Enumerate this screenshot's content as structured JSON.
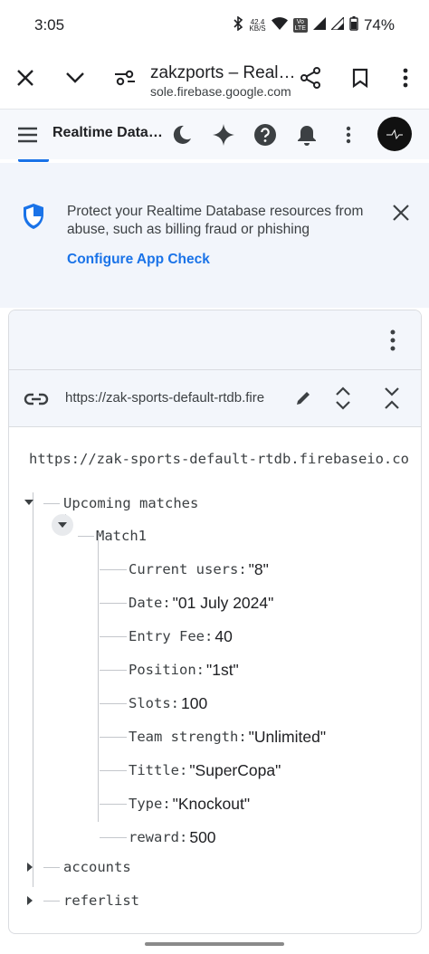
{
  "status_bar": {
    "time": "3:05",
    "net_speed_value": "42.4",
    "net_speed_unit": "KB/S",
    "volte_top": "Vo",
    "volte_bottom": "LTE",
    "battery": "74%"
  },
  "browser": {
    "page_title": "zakzports – Real…",
    "page_url": "sole.firebase.google.com",
    "icons": [
      "close-icon",
      "chevron-down-icon",
      "site-settings-icon",
      "share-icon",
      "bookmark-icon",
      "more-vert-icon"
    ]
  },
  "firebase_header": {
    "title": "Realtime Data…",
    "icons": [
      "menu-icon",
      "dark-mode-icon",
      "gemini-sparkle-icon",
      "help-icon",
      "notifications-icon",
      "more-vert-icon",
      "avatar"
    ]
  },
  "banner": {
    "message": "Protect your Realtime Database resources from abuse, such as billing fraud or phishing",
    "link": "Configure App Check"
  },
  "database": {
    "url": "https://zak-sports-default-rtdb.fire",
    "root_url": "https://zak-sports-default-rtdb.firebaseio.co",
    "tree": {
      "upcoming": "Upcoming matches",
      "match1": "Match1",
      "fields": [
        {
          "key": "Current users",
          "value": "\"8\""
        },
        {
          "key": "Date",
          "value": "\"01 July 2024\""
        },
        {
          "key": "Entry Fee",
          "value": "40"
        },
        {
          "key": "Position",
          "value": "\"1st\""
        },
        {
          "key": "Slots",
          "value": "100"
        },
        {
          "key": "Team strength",
          "value": "\"Unlimited\""
        },
        {
          "key": "Tittle",
          "value": "\"SuperCopa\""
        },
        {
          "key": "Type",
          "value": "\"Knockout\""
        },
        {
          "key": "reward",
          "value": "500"
        }
      ],
      "accounts": "accounts",
      "referlist": "referlist"
    }
  }
}
